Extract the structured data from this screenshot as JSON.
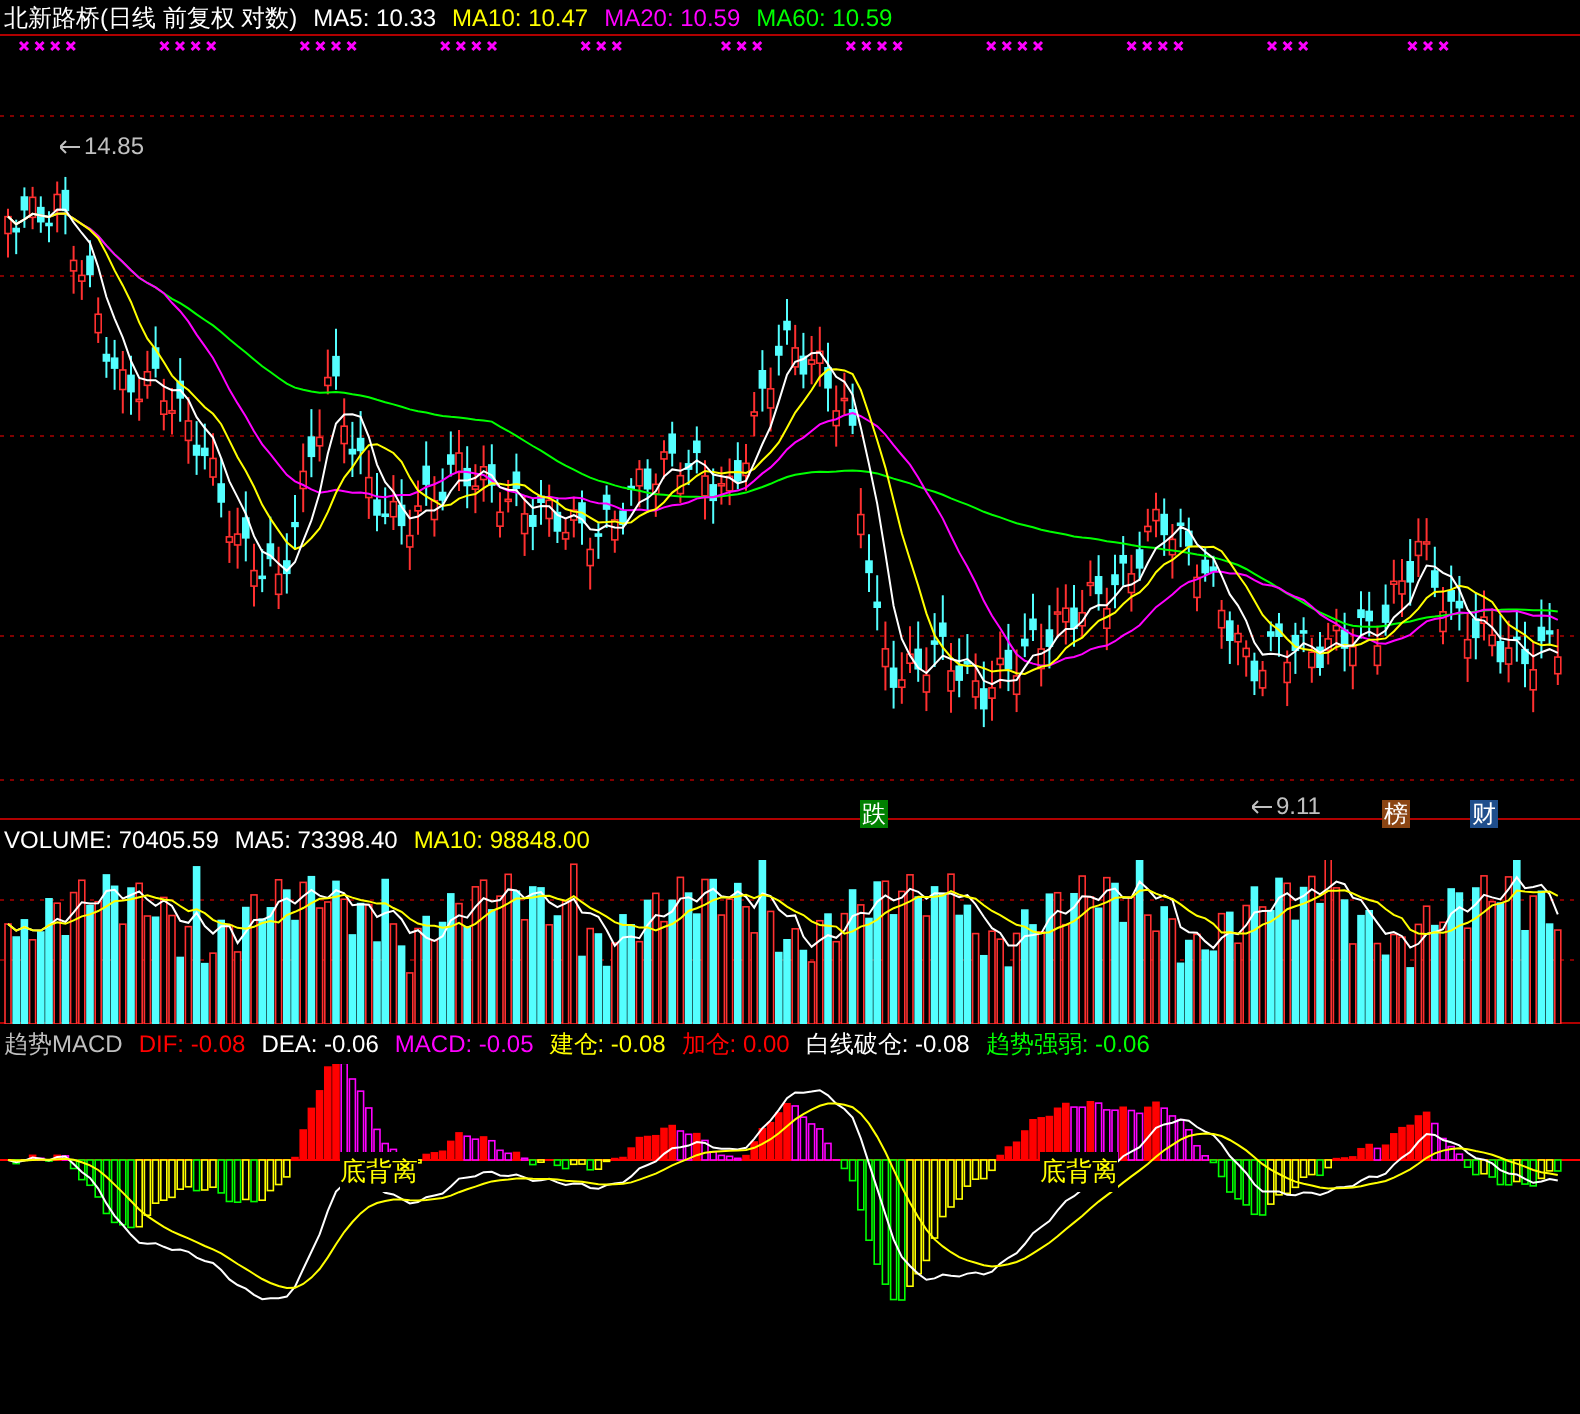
{
  "title": "北新路桥(日线 前复权 对数)",
  "price_indicators": [
    {
      "label": "MA5: 10.33",
      "color": "#ffffff"
    },
    {
      "label": "MA10: 10.47",
      "color": "#ffff00"
    },
    {
      "label": "MA20: 10.59",
      "color": "#ff00ff"
    },
    {
      "label": "MA60: 10.59",
      "color": "#00ff00"
    }
  ],
  "price_annotations": {
    "high": "14.85",
    "low": "9.11"
  },
  "badges": [
    {
      "label": "跌",
      "color": "#008000",
      "kind": "pos1"
    },
    {
      "label": "榜",
      "color": "#8b4513",
      "kind": "pos2"
    },
    {
      "label": "财",
      "color": "#1f4e8c",
      "kind": "pos3"
    }
  ],
  "volume_indicators": [
    {
      "label": "VOLUME: 70405.59",
      "color": "#ffffff"
    },
    {
      "label": "MA5: 73398.40",
      "color": "#ffffff"
    },
    {
      "label": "MA10: 98848.00",
      "color": "#ffff00"
    }
  ],
  "macd_title": "趋势MACD",
  "macd_indicators": [
    {
      "label": "DIF: -0.08",
      "color": "#ff0000"
    },
    {
      "label": "DEA: -0.06",
      "color": "#ffffff"
    },
    {
      "label": "MACD: -0.05",
      "color": "#ff00ff"
    },
    {
      "label": "建仓: -0.08",
      "color": "#ffff00"
    },
    {
      "label": "加仓: 0.00",
      "color": "#ff0000"
    },
    {
      "label": "白线破仓: -0.08",
      "color": "#ffffff"
    },
    {
      "label": "趋势强弱: -0.06",
      "color": "#00ff00"
    }
  ],
  "divergence_labels": [
    "底背离",
    "底背离"
  ]
}
